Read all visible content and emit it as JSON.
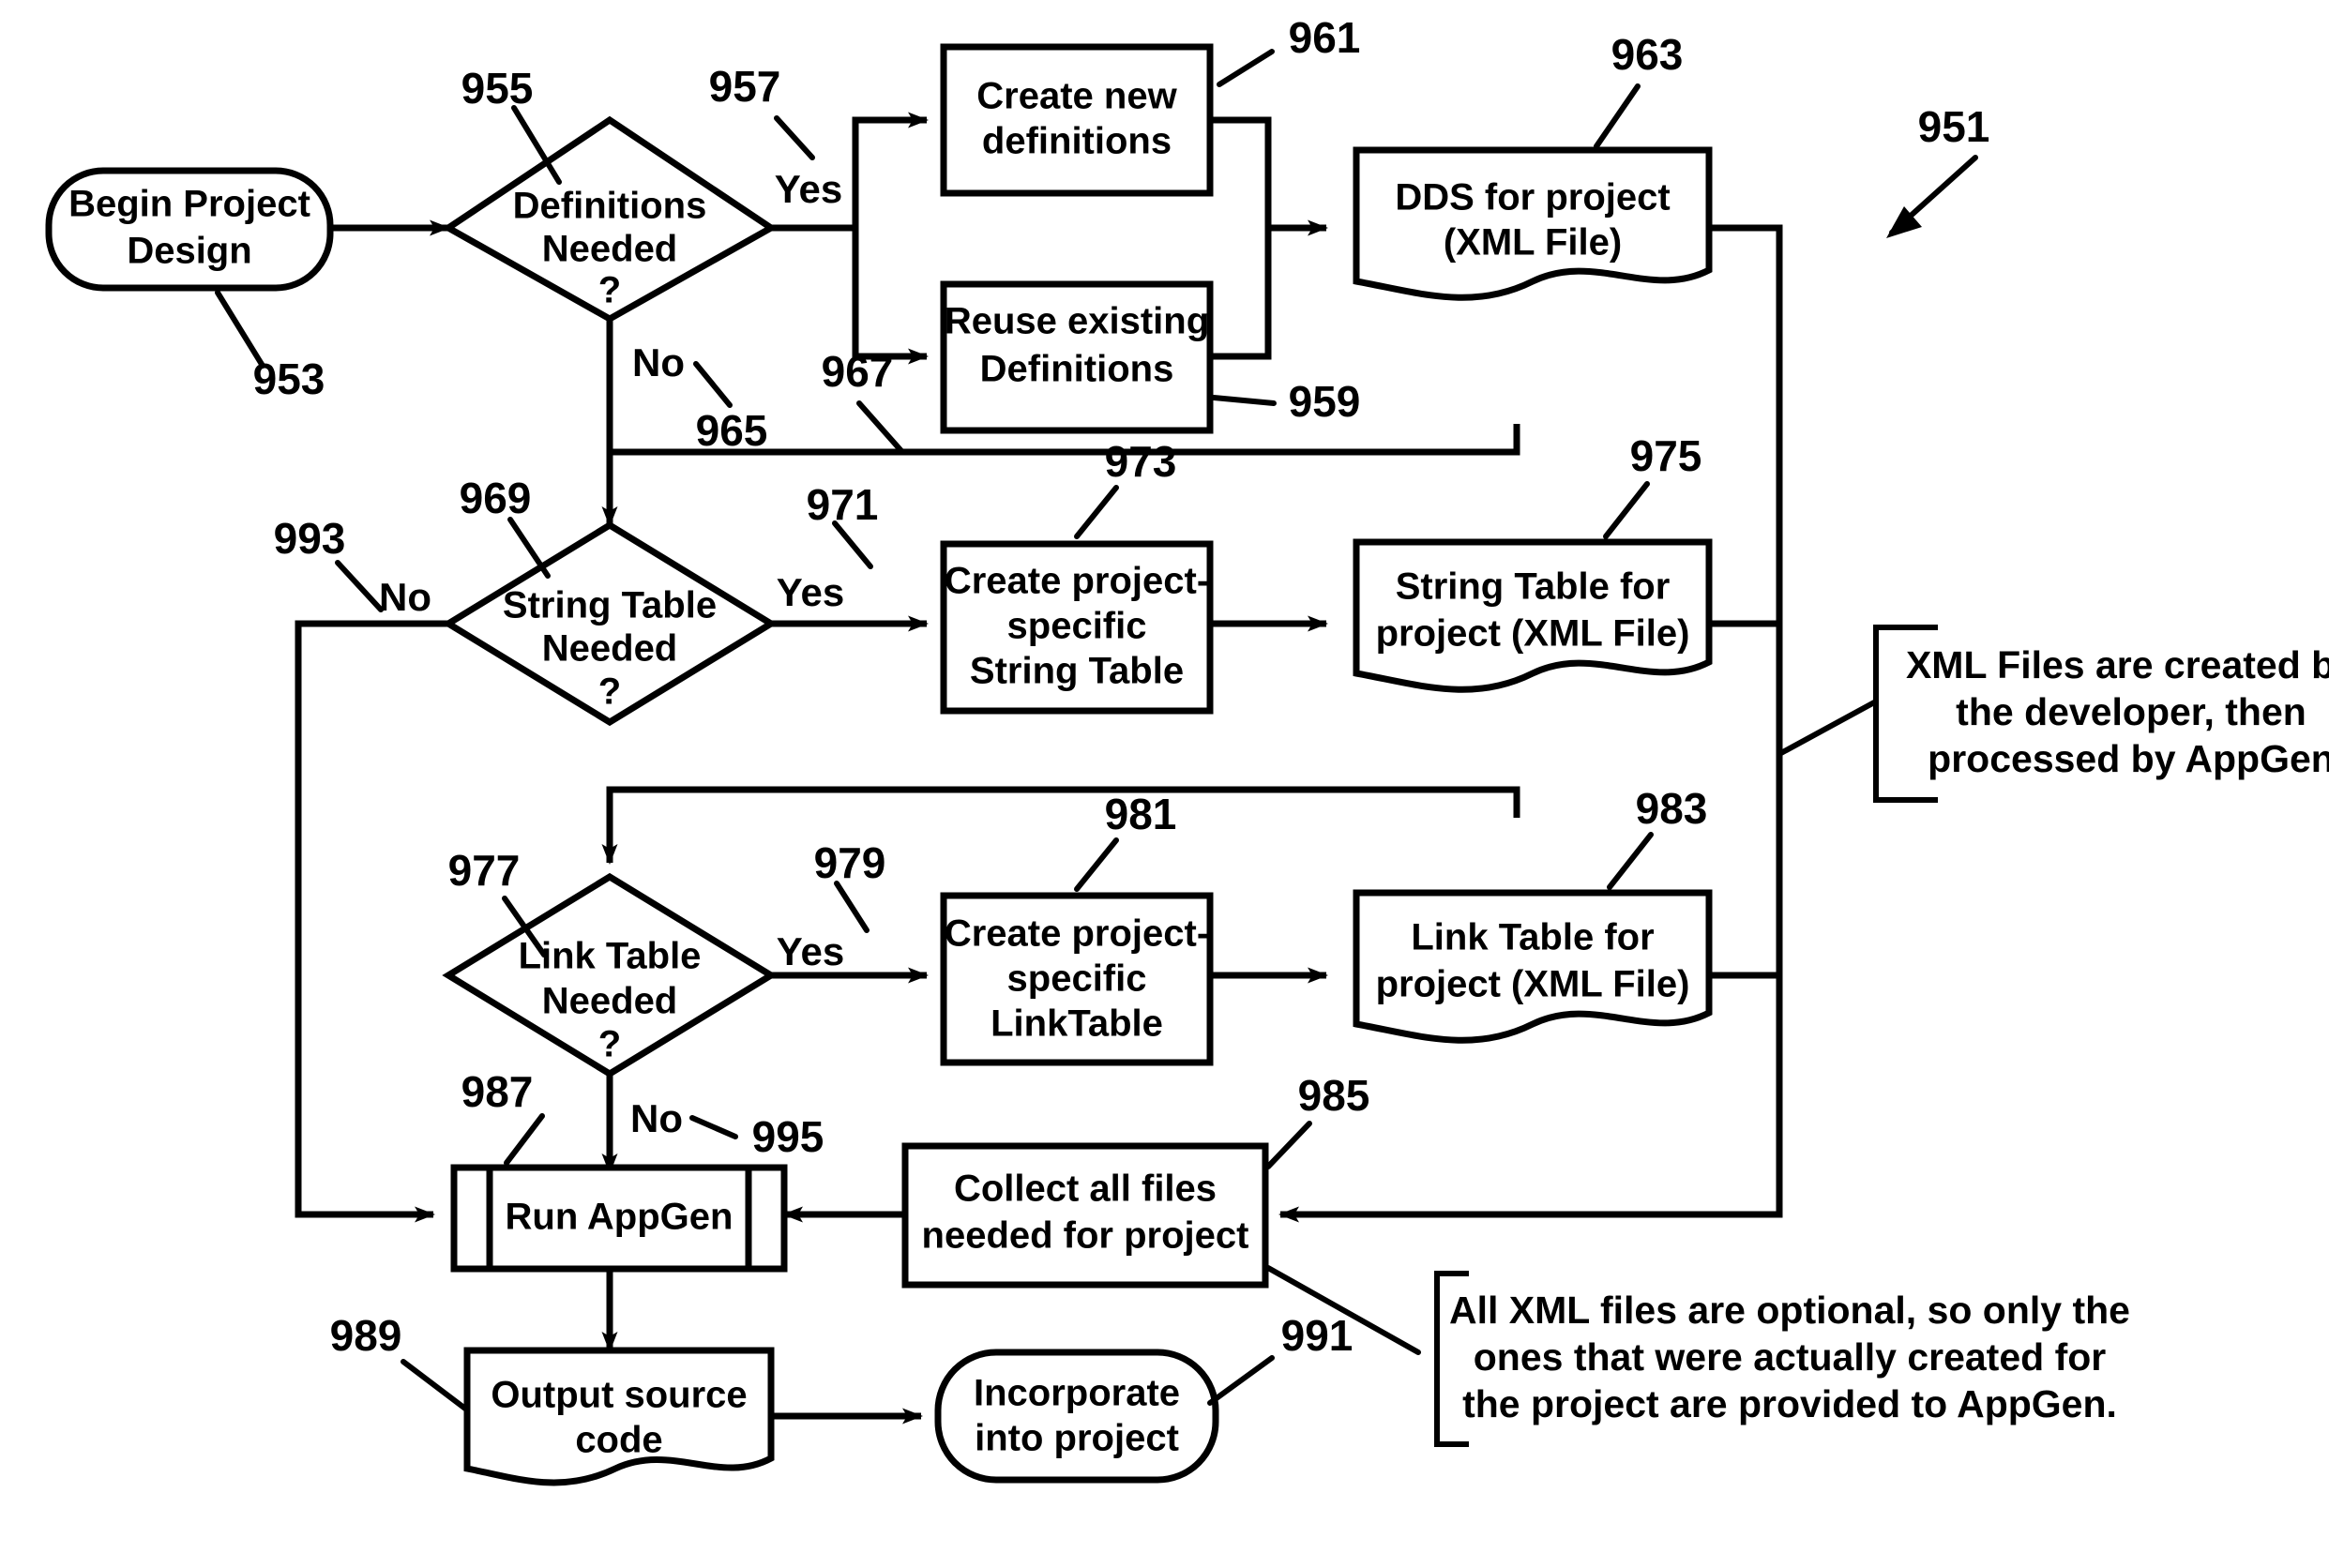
{
  "figure": {
    "type": "patent-flowchart",
    "figure_ref": "951",
    "title_visible": false
  },
  "nodes": {
    "begin": {
      "label_l1": "Begin Project",
      "label_l2": "Design",
      "ref": "953",
      "shape": "terminator"
    },
    "defs_decision": {
      "label_l1": "Definitions",
      "label_l2": "Needed",
      "label_l3": "?",
      "ref": "955",
      "shape": "decision"
    },
    "create_defs": {
      "label_l1": "Create new",
      "label_l2": "definitions",
      "ref": "961",
      "shape": "process"
    },
    "reuse_defs": {
      "label_l1": "Reuse existing",
      "label_l2": "Definitions",
      "ref": "959",
      "shape": "process"
    },
    "dds": {
      "label_l1": "DDS for project",
      "label_l2": "(XML File)",
      "ref": "963",
      "shape": "document"
    },
    "string_decision": {
      "label_l1": "String Table",
      "label_l2": "Needed",
      "label_l3": "?",
      "ref": "969",
      "shape": "decision"
    },
    "create_string": {
      "label_l1": "Create project-",
      "label_l2": "specific",
      "label_l3": "String Table",
      "ref": "973",
      "shape": "process"
    },
    "string_file": {
      "label_l1": "String Table for",
      "label_l2": "project (XML File)",
      "ref": "975",
      "shape": "document"
    },
    "link_decision": {
      "label_l1": "Link Table",
      "label_l2": "Needed",
      "label_l3": "?",
      "ref": "977",
      "shape": "decision"
    },
    "create_link": {
      "label_l1": "Create project-",
      "label_l2": "specific",
      "label_l3": "LinkTable",
      "ref": "981",
      "shape": "process"
    },
    "link_file": {
      "label_l1": "Link Table for",
      "label_l2": "project (XML File)",
      "ref": "983",
      "shape": "document"
    },
    "collect": {
      "label_l1": "Collect all files",
      "label_l2": "needed for project",
      "ref": "985",
      "shape": "process"
    },
    "run_appgen": {
      "label_l1": "Run AppGen",
      "ref": "987",
      "shape": "predefined-process"
    },
    "output_code": {
      "label_l1": "Output source",
      "label_l2": "code",
      "ref": "989",
      "shape": "document"
    },
    "incorporate": {
      "label_l1": "Incorporate",
      "label_l2": "into project",
      "ref": "991",
      "shape": "terminator"
    }
  },
  "edge_labels": {
    "defs_yes": "Yes",
    "defs_no": "No",
    "defs_no_ref": "965",
    "reuse_path_ref": "967",
    "defs_yes_ref": "957",
    "string_yes": "Yes",
    "string_yes_ref": "971",
    "string_no": "No",
    "string_no_ref": "993",
    "link_yes": "Yes",
    "link_yes_ref": "979",
    "link_no": "No",
    "link_no_ref": "995"
  },
  "notes": {
    "xml_note": {
      "line1": "XML Files are created by",
      "line2": "the developer, then",
      "line3": "processed by AppGen"
    },
    "optional_note": {
      "line1": "All XML files are optional, so only the",
      "line2": "ones that were actually created for",
      "line3": "the project are provided to AppGen."
    }
  },
  "colors": {
    "ink": "#000000",
    "paper": "#ffffff"
  }
}
